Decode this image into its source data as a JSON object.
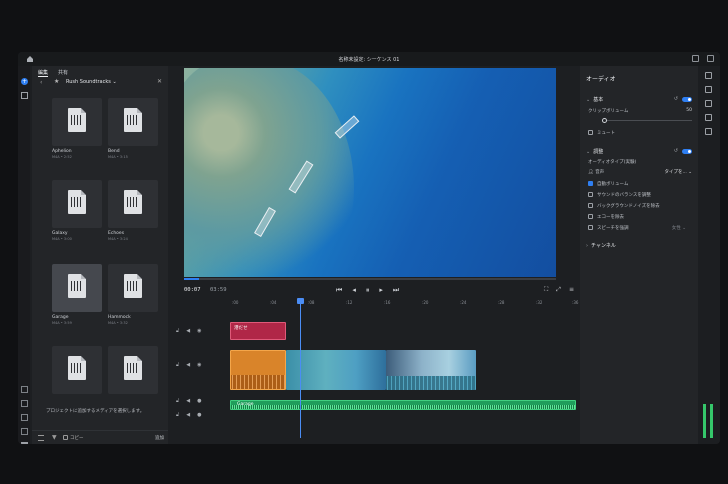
{
  "window": {
    "title": "名称未設定: シーケンス 01"
  },
  "colors": {
    "accent": "#2f7ff2",
    "title_clip": "#b02747",
    "video_clip": "#d9842a",
    "music_clip": "#1f9e5b"
  },
  "media_panel": {
    "tabs": [
      {
        "label": "編集"
      },
      {
        "label": "共有"
      }
    ],
    "folder": "Rush Soundtracks",
    "items": [
      {
        "name": "Aphelion",
        "meta": "M4A • 2:52"
      },
      {
        "name": "Bend",
        "meta": "M4A • 3:15"
      },
      {
        "name": "Galaxy",
        "meta": "M4A • 3:00"
      },
      {
        "name": "Echoes",
        "meta": "M4A • 3:24"
      },
      {
        "name": "Garage",
        "meta": "M4A • 3:59"
      },
      {
        "name": "Hammock",
        "meta": "M4A • 3:32"
      },
      {
        "name": "",
        "meta": ""
      },
      {
        "name": "",
        "meta": ""
      }
    ],
    "footer_message": "プロジェクトに追加するメディアを選択します。",
    "copy_label": "コピー",
    "add_label": "追加"
  },
  "viewer": {
    "current_time": "00:07",
    "duration": "03:59",
    "progress": 0.04
  },
  "ruler_ticks": [
    ":00",
    ":04",
    ":08",
    ":12",
    ":16",
    ":20",
    ":24",
    ":28",
    ":32",
    ":36"
  ],
  "timeline": {
    "title_clip_label": "港だせ",
    "music_clip_label": "Garage"
  },
  "properties": {
    "header": "オーディオ",
    "basic": {
      "label": "基本",
      "clip_volume_label": "クリップボリューム",
      "clip_volume_value": "50",
      "mute_label": "ミュート"
    },
    "adjust": {
      "label": "調整",
      "audio_type_label": "オーディオタイプ(実験)",
      "voice_label": "音声",
      "type_dropdown": "タイプを...",
      "options": [
        {
          "label": "自動ボリューム",
          "checked": true
        },
        {
          "label": "サウンドのバランスを調整",
          "checked": false
        },
        {
          "label": "バックグラウンドノイズを除去",
          "checked": false
        },
        {
          "label": "エコーを除去",
          "checked": false
        },
        {
          "label": "スピーチを強調",
          "checked": false
        }
      ],
      "speech_type": "女性"
    },
    "channels": {
      "label": "チャンネル"
    }
  }
}
